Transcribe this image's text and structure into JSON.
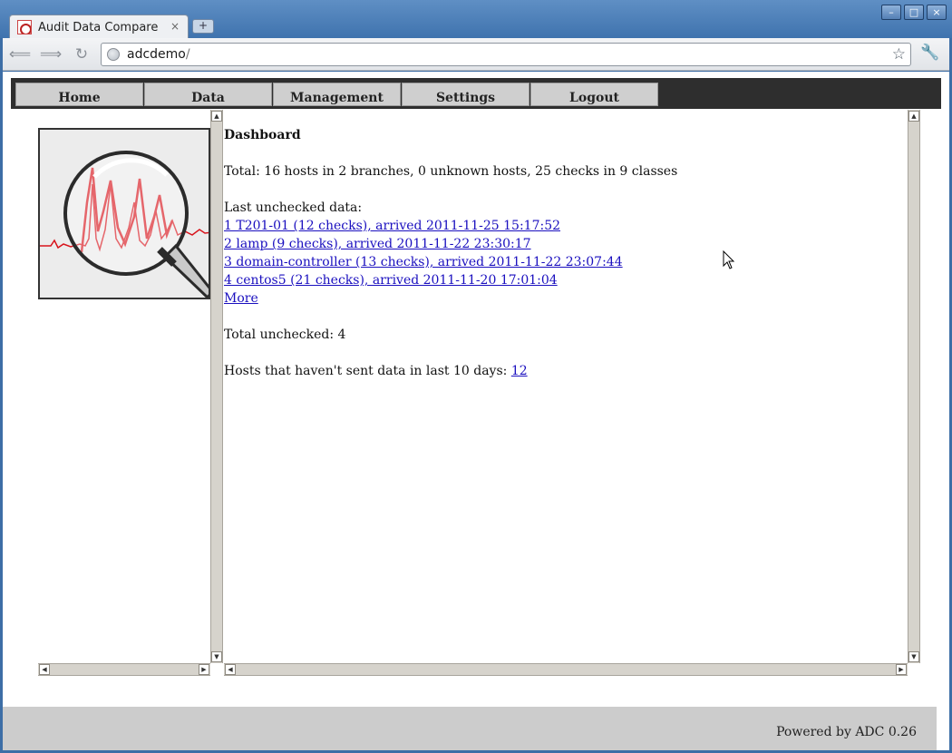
{
  "browser": {
    "tab_title": "Audit Data Compare",
    "tab_close": "×",
    "new_tab": "+",
    "url_host": "adcdemo",
    "url_path": "/",
    "window_buttons": [
      "–",
      "□",
      "×"
    ]
  },
  "menu": {
    "items": [
      {
        "label": "Home"
      },
      {
        "label": "Data"
      },
      {
        "label": "Management"
      },
      {
        "label": "Settings"
      },
      {
        "label": "Logout"
      }
    ]
  },
  "dashboard": {
    "title": "Dashboard",
    "total": "Total: 16 hosts in 2 branches, 0 unknown hosts, 25 checks in 9 classes",
    "last_unchecked_label": "Last unchecked data:",
    "unchecked_items": [
      "1 T201-01 (12 checks), arrived 2011-11-25 15:17:52",
      "2 lamp (9 checks), arrived 2011-11-22 23:30:17",
      "3 domain-controller (13 checks), arrived 2011-11-22 23:07:44",
      "4 centos5 (21 checks), arrived 2011-11-20 17:01:04"
    ],
    "more_link": "More",
    "total_unchecked": "Total unchecked: 4",
    "stale_hosts_label": "Hosts that haven't sent data in last 10 days: ",
    "stale_hosts_count": "12"
  },
  "footer": {
    "powered_by": "Powered by ADC 0.26"
  },
  "colors": {
    "link": "#1a0fbf",
    "menubar": "#2e2e2e",
    "menu_button": "#cfcfcf",
    "footer": "#cccccc",
    "logo_red": "#d8141c"
  }
}
